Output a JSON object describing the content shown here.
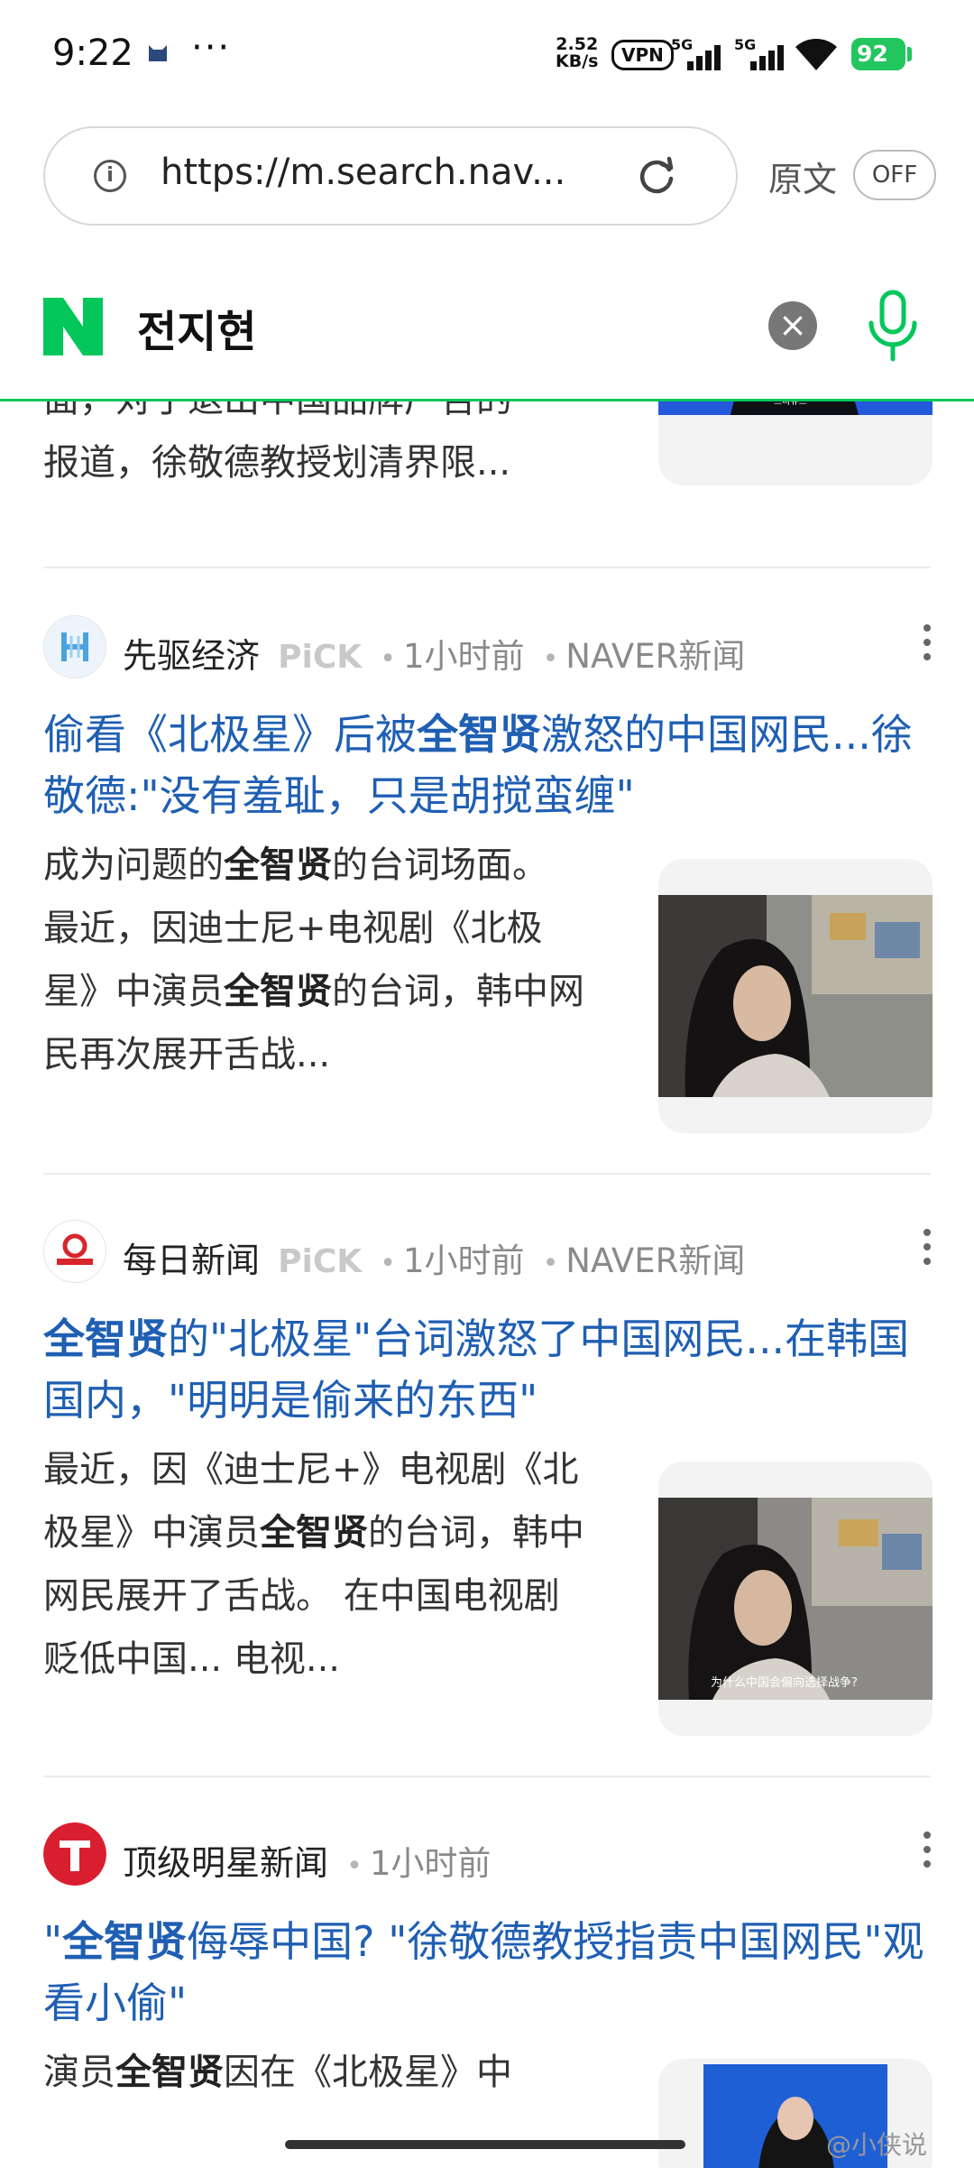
{
  "status_bar": {
    "time": "9:22",
    "dots": "···",
    "net_speed_value": "2.52",
    "net_speed_unit": "KB/s",
    "vpn": "VPN",
    "sim1": "5G",
    "sim2": "5G",
    "battery": "92"
  },
  "browser": {
    "url": "https://m.search.nav...",
    "translate_label": "原文",
    "translate_toggle": "OFF"
  },
  "search": {
    "query": "전지현",
    "accent_color": "#03c75a"
  },
  "partial_article": {
    "line1": "面，对于退出中国品牌广告的",
    "line2": "报道，徐敬德教授划清界限..."
  },
  "articles": [
    {
      "source": "先驱经济",
      "pick": "PiCK",
      "time": "1小时前",
      "channel": "NAVER新闻",
      "title_parts": [
        "偷看《北极星》后被",
        "全智贤",
        "激怒的中国网民...徐敬德:\"没有羞耻，只是胡搅蛮缠\""
      ],
      "summary_parts": [
        "成为问题的",
        "全智贤",
        "的台词场面。 最近，因迪士尼+电视剧《北极星》中演员",
        "全智贤",
        "的台词，韩中网民再次展开舌战..."
      ]
    },
    {
      "source": "每日新闻",
      "pick": "PiCK",
      "time": "1小时前",
      "channel": "NAVER新闻",
      "title_parts": [
        "全智贤",
        "的\"北极星\"台词激怒了中国网民...在韩国国内，\"明明是偷来的东西\""
      ],
      "summary_parts": [
        "最近，因《迪士尼+》电视剧《北极星》中演员",
        "全智贤",
        "的台词，韩中网民展开了舌战。 在中国电视剧贬低中国... 电视..."
      ],
      "thumb_caption": "为什么中国会偏向选择战争?"
    },
    {
      "source": "顶级明星新闻",
      "time": "1小时前",
      "title_parts": [
        "\"",
        "全智贤",
        "侮辱中国? \"徐敬德教授指责中国网民\"观看小偷\""
      ],
      "summary_parts": [
        "演员",
        "全智贤",
        "因在《北极星》中"
      ]
    }
  ],
  "watermark": "@小侠说"
}
